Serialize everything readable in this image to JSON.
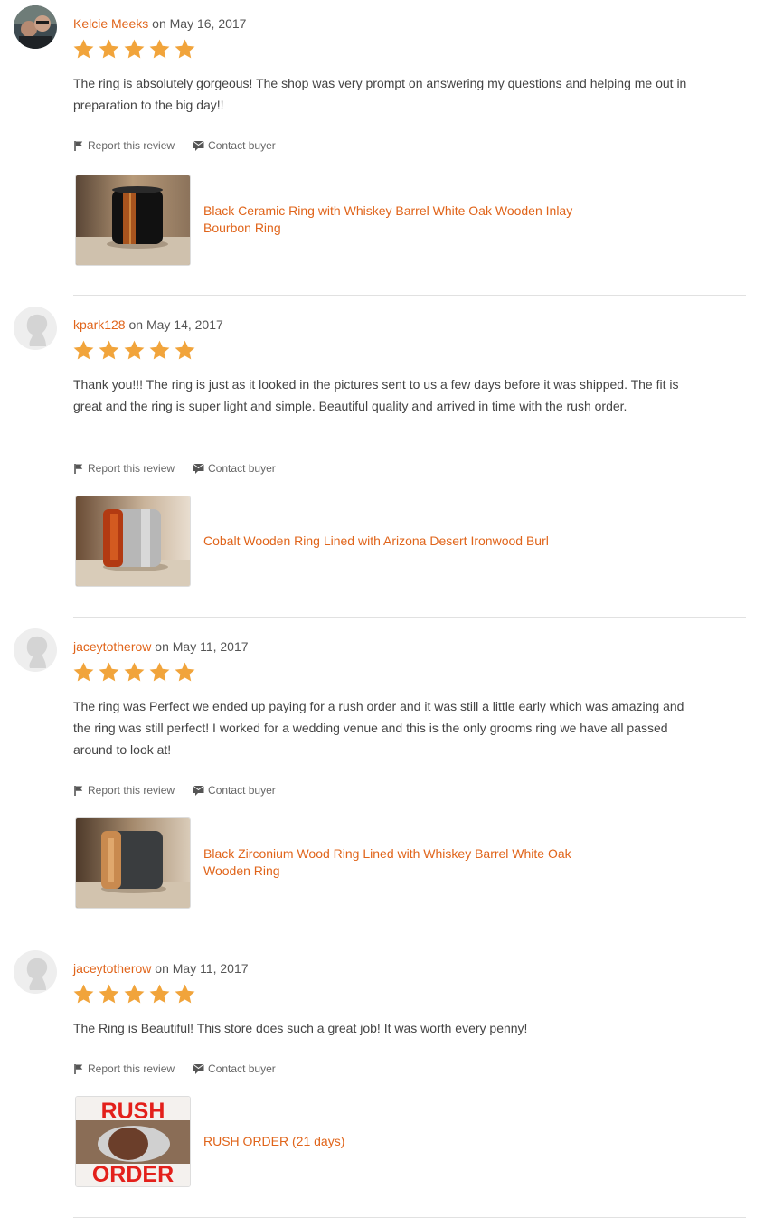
{
  "labels": {
    "report": "Report this review",
    "contact": "Contact buyer",
    "on": "on"
  },
  "colors": {
    "accent": "#e0641a",
    "star": "#f1a43b",
    "text": "#444444",
    "divider": "#e1e1e1"
  },
  "icons": {
    "report": "flag-icon",
    "contact": "envelope-icon",
    "rating": "star-icon"
  },
  "reviews": [
    {
      "user": "Kelcie Meeks",
      "date": "May 16, 2017",
      "rating": 5,
      "text": "The ring is absolutely gorgeous! The shop was very prompt on answering my questions and helping me out in preparation to the big day!!",
      "product": "Black Ceramic Ring with Whiskey Barrel White Oak Wooden Inlay Bourbon Ring"
    },
    {
      "user": "kpark128",
      "date": "May 14, 2017",
      "rating": 5,
      "text": "Thank you!!! The ring is just as it looked in the pictures sent to us a few days before it was shipped. The fit is great and the ring is super light and simple. Beautiful quality and arrived in time with the rush order.",
      "product": "Cobalt Wooden Ring Lined with Arizona Desert Ironwood Burl"
    },
    {
      "user": "jaceytotherow",
      "date": "May 11, 2017",
      "rating": 5,
      "text": "The ring was Perfect we ended up paying for a rush order and it was still a little early which was amazing and the ring was still perfect! I worked for a wedding venue and this is the only grooms ring we have all passed around to look at!",
      "product": "Black Zirconium Wood Ring Lined with Whiskey Barrel White Oak Wooden Ring"
    },
    {
      "user": "jaceytotherow",
      "date": "May 11, 2017",
      "rating": 5,
      "text": "The Ring is Beautiful! This store does such a great job! It was worth every penny!",
      "product": "RUSH ORDER (21 days)",
      "thumb_text_top": "RUSH",
      "thumb_text_bottom": "ORDER"
    }
  ]
}
